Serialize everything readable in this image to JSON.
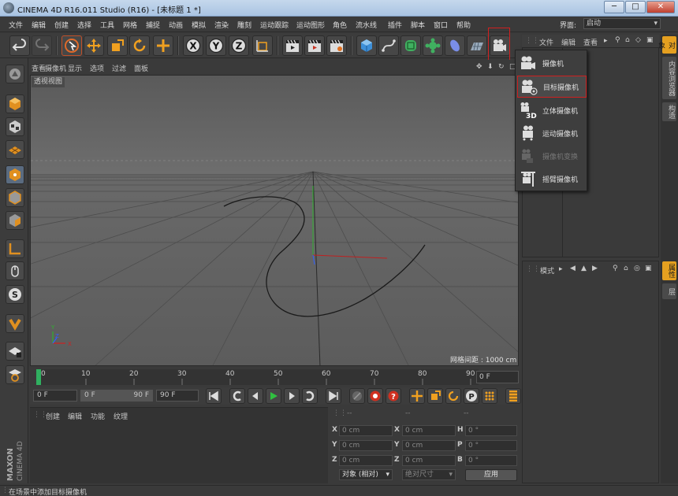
{
  "window": {
    "title": "CINEMA 4D R16.011 Studio (R16) - [未标题 1 *]",
    "minimize_glyph": "─",
    "restore_glyph": "□",
    "close_glyph": "✕"
  },
  "menubar": {
    "items": [
      "文件",
      "编辑",
      "创建",
      "选择",
      "工具",
      "网格",
      "捕捉",
      "动画",
      "模拟",
      "渲染",
      "雕刻",
      "运动跟踪",
      "运动图形",
      "角色",
      "流水线",
      "插件",
      "脚本",
      "窗口",
      "帮助"
    ],
    "layout_label": "界面:",
    "layout_value": "启动"
  },
  "toolbar": {
    "x_label": "X",
    "y_label": "Y",
    "z_label": "Z"
  },
  "viewport": {
    "menu": [
      "查看",
      "摄像机",
      "显示",
      "选项",
      "过滤",
      "面板"
    ],
    "label": "透视视图",
    "grid_spacing": "网格间距 : 1000 cm",
    "axis_labels": {
      "x": "X",
      "y": "Y",
      "z": "Z"
    }
  },
  "timeline": {
    "ticks": [
      "0",
      "10",
      "20",
      "30",
      "40",
      "50",
      "60",
      "70",
      "80",
      "90"
    ],
    "current_frame": "0 F"
  },
  "playback": {
    "start_field": "0 F",
    "range_min": "0 F",
    "range_max": "90 F",
    "end_field": "90 F"
  },
  "material_panel": {
    "menu": [
      "创建",
      "编辑",
      "功能",
      "纹理"
    ]
  },
  "coordinates": {
    "headers": [
      "--",
      "--",
      "--"
    ],
    "rows": [
      {
        "a_label": "X",
        "a_value": "0 cm",
        "b_label": "X",
        "b_value": "0 cm",
        "c_label": "H",
        "c_value": "0 °"
      },
      {
        "a_label": "Y",
        "a_value": "0 cm",
        "b_label": "Y",
        "b_value": "0 cm",
        "c_label": "P",
        "c_value": "0 °"
      },
      {
        "a_label": "Z",
        "a_value": "0 cm",
        "b_label": "Z",
        "b_value": "0 cm",
        "c_label": "B",
        "c_value": "0 °"
      }
    ],
    "mode_select": "对象 (相对)",
    "size_select": "绝对尺寸",
    "apply": "应用"
  },
  "object_manager": {
    "menu": [
      "文件",
      "编辑",
      "查看"
    ]
  },
  "attribute_manager": {
    "menu": [
      "模式"
    ]
  },
  "side_tabs": [
    "对象",
    "内容浏览器",
    "构造",
    "属性",
    "层"
  ],
  "camera_dropdown": {
    "items": [
      {
        "label": "摄像机",
        "state": "normal"
      },
      {
        "label": "目标摄像机",
        "state": "highlighted"
      },
      {
        "label": "立体摄像机",
        "state": "normal"
      },
      {
        "label": "运动摄像机",
        "state": "normal"
      },
      {
        "label": "摄像机变换",
        "state": "disabled"
      },
      {
        "label": "摇臂摄像机",
        "state": "normal"
      }
    ],
    "stereo_badge": "3D"
  },
  "statusbar": {
    "text": "在场景中添加目标摄像机"
  },
  "brand": {
    "maxon": "MAXON",
    "cinema": "CINEMA 4D"
  },
  "colors": {
    "accent": "#e5a020",
    "highlight_border": "#d02020",
    "x_axis": "#d02020",
    "y_axis": "#30b030",
    "z_axis": "#3060ff"
  }
}
